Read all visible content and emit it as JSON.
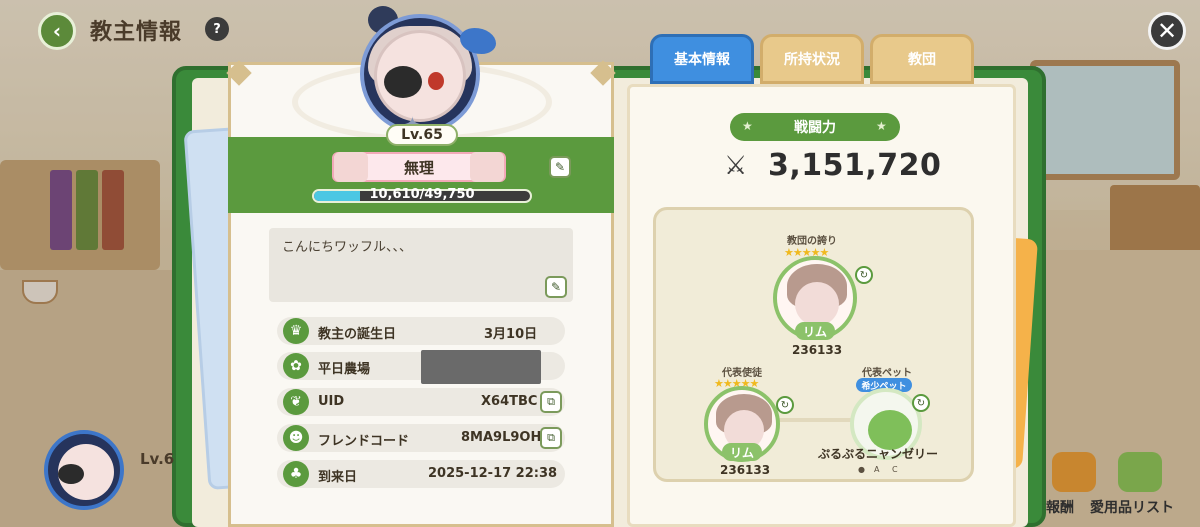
{
  "header": {
    "title": "教主情報",
    "help_icon": "?"
  },
  "close_icon": "✕",
  "back_icon": "‹",
  "profile": {
    "level": "Lv.65",
    "name": "無理",
    "exp_text": "10,610/49,750",
    "exp_current": 10610,
    "exp_max": 49750,
    "comment": "こんにちワッフル、、、"
  },
  "info_rows": [
    {
      "label": "教主の誕生日",
      "value": "3月10日",
      "icon": "cake-icon"
    },
    {
      "label": "平日農場",
      "value": "",
      "icon": "farm-icon"
    },
    {
      "label": "UID",
      "value": "X64TBC",
      "icon": "leaf-icon"
    },
    {
      "label": "フレンドコード",
      "value": "8MA9L9OH",
      "icon": "friends-icon"
    },
    {
      "label": "到来日",
      "value": "2025-12-17 22:38",
      "icon": "clover-icon"
    }
  ],
  "tabs": [
    {
      "label": "基本情報",
      "active": true
    },
    {
      "label": "所持状況",
      "active": false
    },
    {
      "label": "教団",
      "active": false
    }
  ],
  "power": {
    "label": "戦闘力",
    "value": "3,151,720"
  },
  "formation": {
    "pride": {
      "label": "教団の誇り",
      "name": "リム",
      "id": "236133",
      "stars": "★★★★★"
    },
    "rep_disciple": {
      "label": "代表使徒",
      "name": "リム",
      "id": "236133",
      "stars": "★★★★★"
    },
    "rep_pet": {
      "label": "代表ペット",
      "badge": "希少ペット",
      "name": "ぷるぷるニャンゼリー",
      "grades": [
        "A",
        "C"
      ]
    }
  },
  "mini_profile": {
    "level": "Lv.6"
  },
  "bottom_buttons": [
    "報酬",
    "愛用品リスト"
  ],
  "colors": {
    "green": "#5b9a3e",
    "blue_tab": "#3f8fe0",
    "gold": "#d6bf8e"
  }
}
